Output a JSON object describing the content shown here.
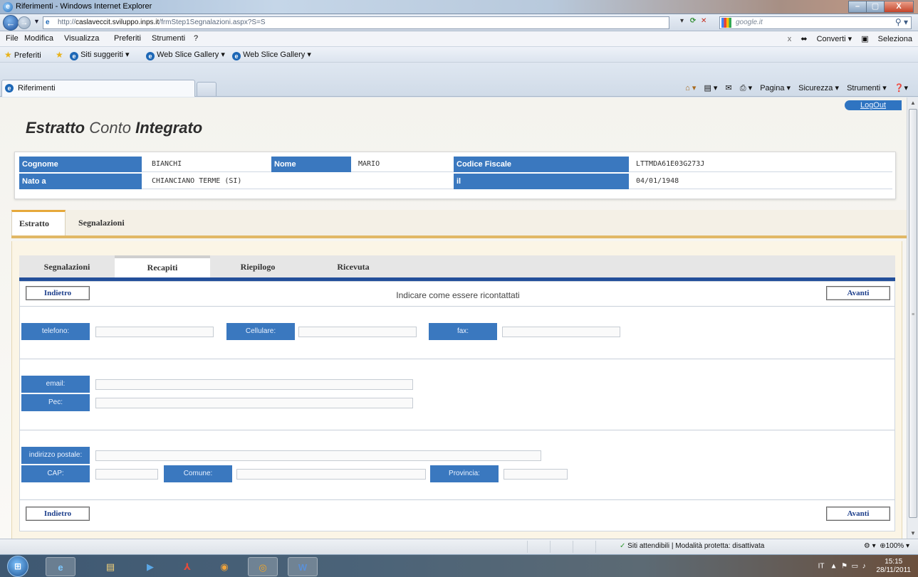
{
  "window": {
    "title": "Riferimenti - Windows Internet Explorer",
    "min": "–",
    "max": "▢",
    "close": "X"
  },
  "addressbar": {
    "url_prefix": "http://",
    "url_host": "caslaveccit.sviluppo.inps.it",
    "url_path": "/frmStep1Segnalazioni.aspx?S=S",
    "search_placeholder": "google.it"
  },
  "menubar": {
    "items": [
      "File",
      "Modifica",
      "Visualizza",
      "Preferiti",
      "Strumenti",
      "?"
    ],
    "converti": "Converti",
    "seleziona": "Seleziona"
  },
  "favbar": {
    "preferiti": "Preferiti",
    "items": [
      "Siti suggeriti ▾",
      "Web Slice Gallery ▾",
      "Web Slice Gallery ▾"
    ]
  },
  "tabs": {
    "active_tab": "Riferimenti",
    "cmd": [
      "Pagina ▾",
      "Sicurezza ▾",
      "Strumenti ▾"
    ]
  },
  "app": {
    "logout": "LogOut",
    "title_bold1": "Estratto",
    "title_light": "Conto",
    "title_bold2": "Integrato"
  },
  "person": {
    "cognome_label": "Cognome",
    "cognome": "BIANCHI",
    "nome_label": "Nome",
    "nome": "MARIO",
    "cf_label": "Codice Fiscale",
    "cf": "LTTMDA61E03G273J",
    "nato_label": "Nato a",
    "nato": "CHIANCIANO TERME (SI)",
    "il_label": "il",
    "il": "04/01/1948"
  },
  "main_tabs": [
    "Estratto",
    "Segnalazioni"
  ],
  "step_tabs": [
    "Segnalazioni",
    "Recapiti",
    "Riepilogo",
    "Ricevuta"
  ],
  "form": {
    "back_label": "Indietro",
    "next_label": "Avanti",
    "instruction": "Indicare come essere ricontattati",
    "telefono": "telefono:",
    "cellulare": "Cellulare:",
    "fax": "fax:",
    "email": "email:",
    "pec": "Pec:",
    "indirizzo": "indirizzo postale:",
    "cap": "CAP:",
    "comune": "Comune:",
    "provincia": "Provincia:"
  },
  "statusbar": {
    "security": "Siti attendibili | Modalità protetta: disattivata",
    "zoom": "100%"
  },
  "taskbar": {
    "lang": "IT",
    "time": "15:15",
    "date": "28/11/2011"
  }
}
